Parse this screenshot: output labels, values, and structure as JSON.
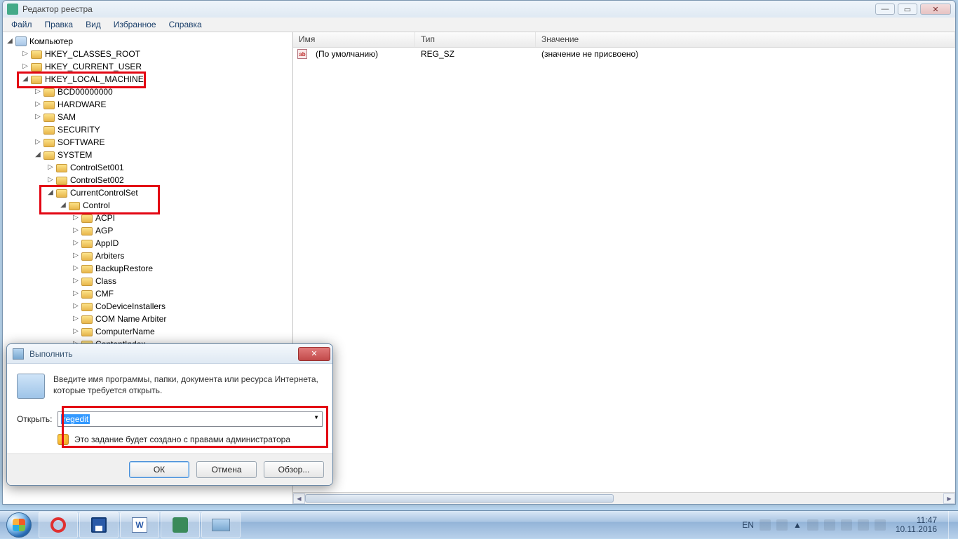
{
  "app": {
    "title": "Редактор реестра"
  },
  "menu": [
    "Файл",
    "Правка",
    "Вид",
    "Избранное",
    "Справка"
  ],
  "tree": {
    "root": "Компьютер",
    "items": [
      {
        "d": 1,
        "exp": "▷",
        "label": "HKEY_CLASSES_ROOT"
      },
      {
        "d": 1,
        "exp": "▷",
        "label": "HKEY_CURRENT_USER"
      },
      {
        "d": 1,
        "exp": "◢",
        "label": "HKEY_LOCAL_MACHINE"
      },
      {
        "d": 2,
        "exp": "▷",
        "label": "BCD00000000"
      },
      {
        "d": 2,
        "exp": "▷",
        "label": "HARDWARE"
      },
      {
        "d": 2,
        "exp": "▷",
        "label": "SAM"
      },
      {
        "d": 2,
        "exp": "",
        "label": "SECURITY"
      },
      {
        "d": 2,
        "exp": "▷",
        "label": "SOFTWARE"
      },
      {
        "d": 2,
        "exp": "◢",
        "label": "SYSTEM"
      },
      {
        "d": 3,
        "exp": "▷",
        "label": "ControlSet001"
      },
      {
        "d": 3,
        "exp": "▷",
        "label": "ControlSet002"
      },
      {
        "d": 3,
        "exp": "◢",
        "label": "CurrentControlSet"
      },
      {
        "d": 4,
        "exp": "◢",
        "label": "Control"
      },
      {
        "d": 5,
        "exp": "▷",
        "label": "ACPI"
      },
      {
        "d": 5,
        "exp": "▷",
        "label": "AGP"
      },
      {
        "d": 5,
        "exp": "▷",
        "label": "AppID"
      },
      {
        "d": 5,
        "exp": "▷",
        "label": "Arbiters"
      },
      {
        "d": 5,
        "exp": "▷",
        "label": "BackupRestore"
      },
      {
        "d": 5,
        "exp": "▷",
        "label": "Class"
      },
      {
        "d": 5,
        "exp": "▷",
        "label": "CMF"
      },
      {
        "d": 5,
        "exp": "▷",
        "label": "CoDeviceInstallers"
      },
      {
        "d": 5,
        "exp": "▷",
        "label": "COM Name Arbiter"
      },
      {
        "d": 5,
        "exp": "▷",
        "label": "ComputerName"
      },
      {
        "d": 5,
        "exp": "▷",
        "label": "ContentIndex"
      }
    ]
  },
  "list": {
    "columns": [
      "Имя",
      "Тип",
      "Значение"
    ],
    "rows": [
      {
        "name": "(По умолчанию)",
        "type": "REG_SZ",
        "value": "(значение не присвоено)",
        "icon": "ab"
      }
    ]
  },
  "run": {
    "title": "Выполнить",
    "desc": "Введите имя программы, папки, документа или ресурса Интернета, которые требуется открыть.",
    "open_label": "Открыть:",
    "input_value": "regedit",
    "admin_note": "Это задание будет создано с правами администратора",
    "buttons": {
      "ok": "ОК",
      "cancel": "Отмена",
      "browse": "Обзор..."
    }
  },
  "tray": {
    "lang": "EN",
    "time": "11:47",
    "date": "10.11.2016"
  }
}
